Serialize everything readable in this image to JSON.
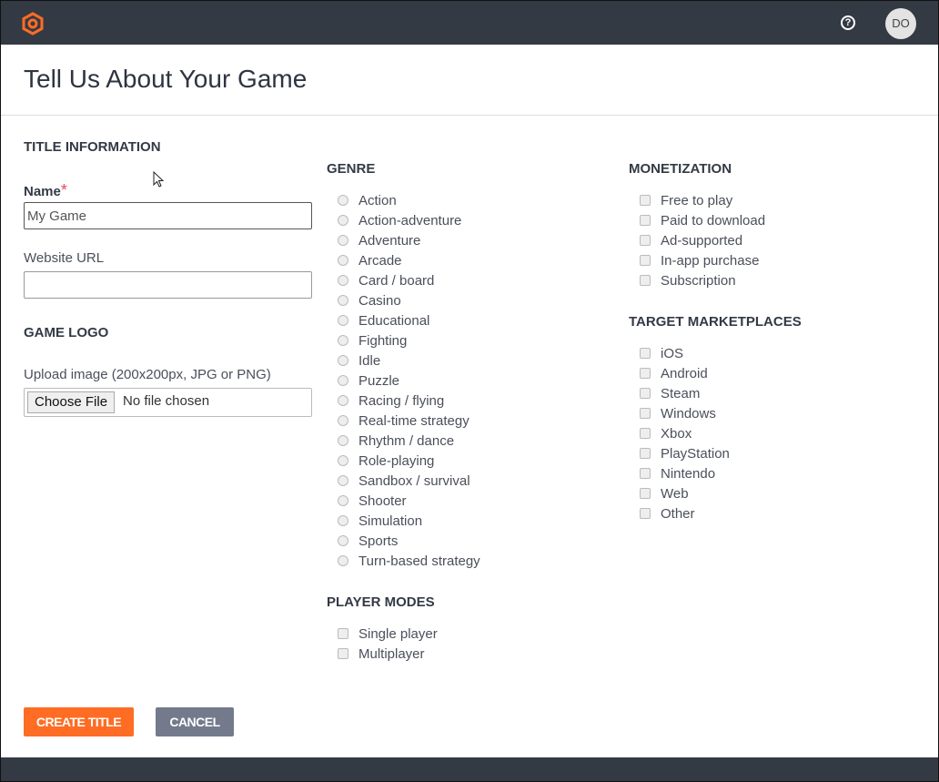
{
  "header": {
    "help_icon": "question-circle",
    "avatar_initials": "DO"
  },
  "page_title": "Tell Us About Your Game",
  "title_info": {
    "heading": "TITLE INFORMATION",
    "name_label": "Name",
    "required_mark": "*",
    "name_value": "My Game",
    "website_label": "Website URL",
    "website_value": ""
  },
  "game_logo": {
    "heading": "GAME LOGO",
    "upload_label": "Upload image (200x200px, JPG or PNG)",
    "choose_file": "Choose File",
    "no_file": "No file chosen"
  },
  "genre": {
    "heading": "GENRE",
    "options": [
      "Action",
      "Action-adventure",
      "Adventure",
      "Arcade",
      "Card / board",
      "Casino",
      "Educational",
      "Fighting",
      "Idle",
      "Puzzle",
      "Racing / flying",
      "Real-time strategy",
      "Rhythm / dance",
      "Role-playing",
      "Sandbox / survival",
      "Shooter",
      "Simulation",
      "Sports",
      "Turn-based strategy"
    ]
  },
  "player_modes": {
    "heading": "PLAYER MODES",
    "options": [
      "Single player",
      "Multiplayer"
    ]
  },
  "monetization": {
    "heading": "MONETIZATION",
    "options": [
      "Free to play",
      "Paid to download",
      "Ad-supported",
      "In-app purchase",
      "Subscription"
    ]
  },
  "marketplaces": {
    "heading": "TARGET MARKETPLACES",
    "options": [
      "iOS",
      "Android",
      "Steam",
      "Windows",
      "Xbox",
      "PlayStation",
      "Nintendo",
      "Web",
      "Other"
    ]
  },
  "actions": {
    "create": "CREATE TITLE",
    "cancel": "CANCEL"
  },
  "colors": {
    "topbar": "#343a44",
    "accent": "#ff6c23",
    "cancel": "#737a8c"
  }
}
